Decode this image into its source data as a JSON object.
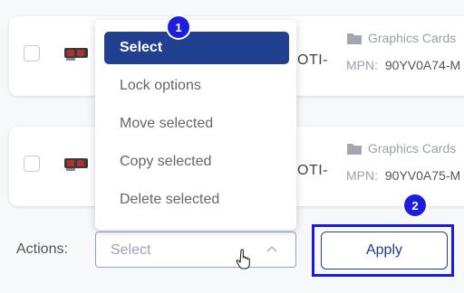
{
  "products": [
    {
      "name_fragment": "OTI-",
      "category": "Graphics Cards",
      "mpn_label": "MPN:",
      "mpn_value": "90YV0A74-M"
    },
    {
      "name_fragment": "OTI-",
      "category": "Graphics Cards",
      "mpn_label": "MPN:",
      "mpn_value": "90YV0A75-M"
    }
  ],
  "actions": {
    "label": "Actions:",
    "select_value": "Select",
    "apply_label": "Apply"
  },
  "dropdown": {
    "options": [
      "Select",
      "Lock options",
      "Move selected",
      "Copy selected",
      "Delete selected"
    ],
    "selected_index": 0
  },
  "annotations": {
    "badge1": "1",
    "badge2": "2",
    "highlight_color": "#1b1bdd"
  },
  "colors": {
    "selected_option_bg": "#21408f",
    "apply_text": "#1f3c88"
  }
}
